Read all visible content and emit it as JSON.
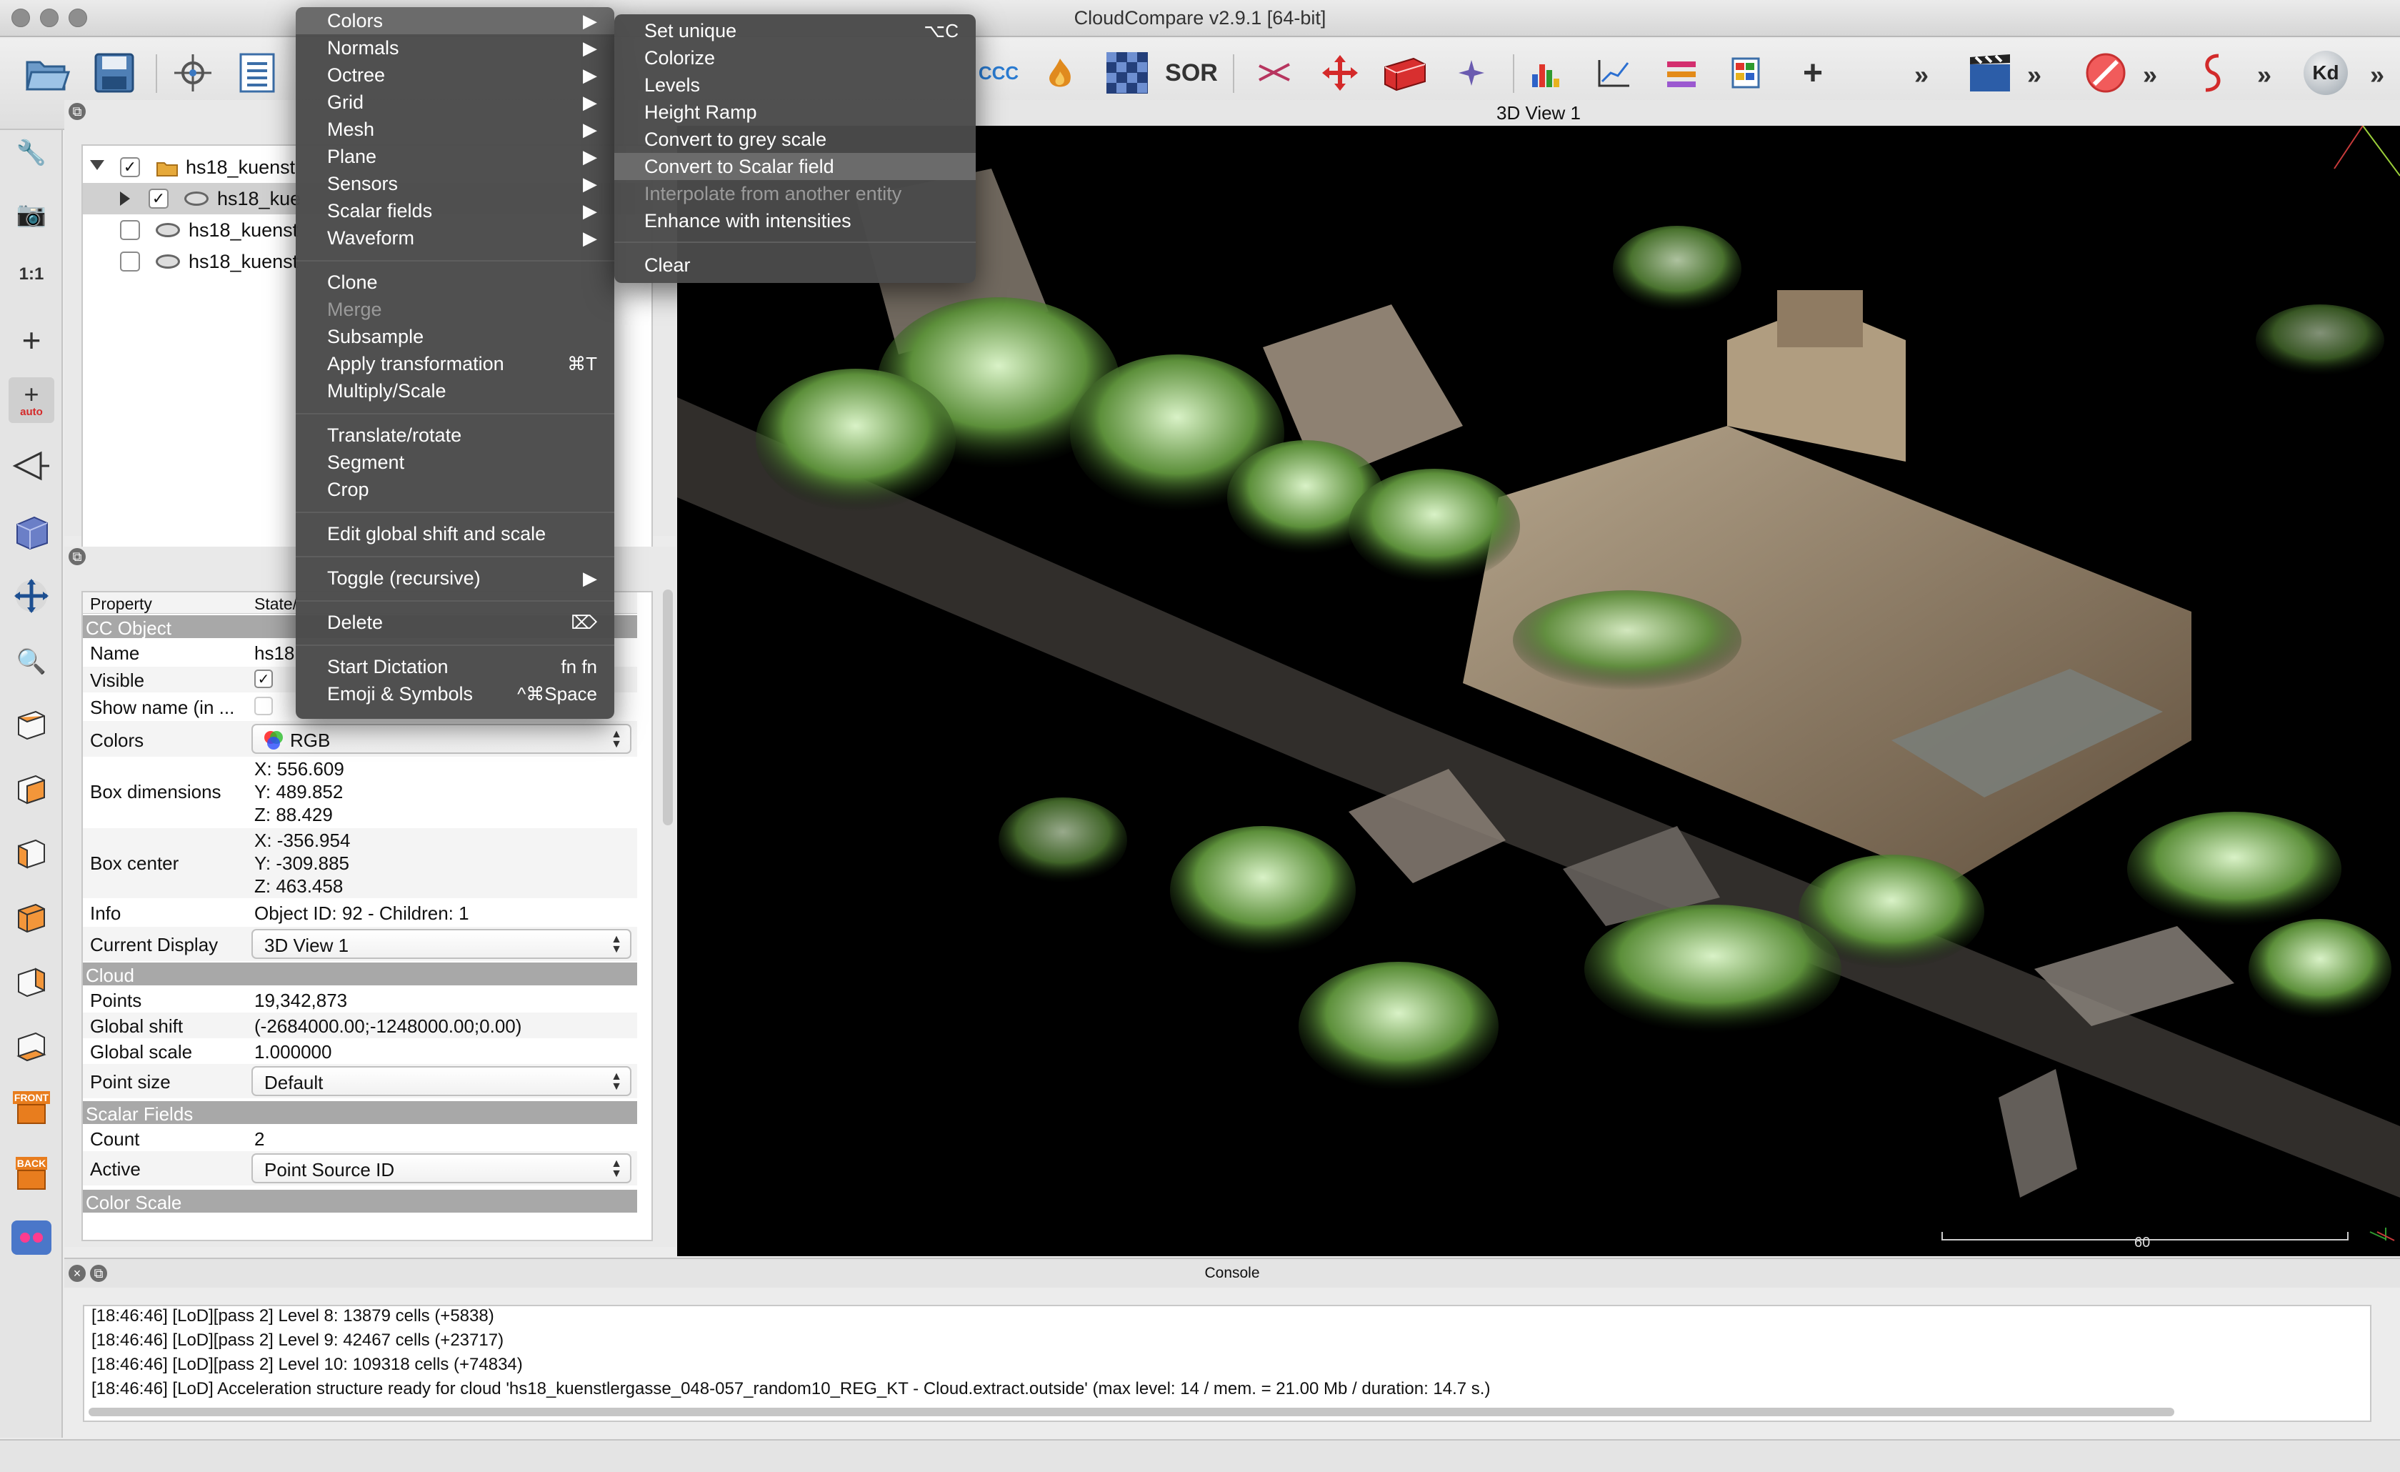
{
  "window": {
    "title": "CloudCompare v2.9.1 [64-bit]"
  },
  "toolbar": {
    "items": [
      "open-icon",
      "save-icon",
      "point-picking-icon",
      "properties-icon",
      "ccc-icon",
      "fire-icon",
      "checkerboard-icon",
      "sor-icon",
      "scissors-icon",
      "translate-icon",
      "red-box-icon",
      "fit-icon",
      "histogram-icon",
      "plot-icon",
      "minmax-icon",
      "table-icon",
      "plus-icon",
      "animation-icon",
      "stop-icon",
      "snake-icon",
      "kd-icon"
    ],
    "labels": {
      "ccc": "CCC",
      "sor": "SOR",
      "kd": "Kd"
    }
  },
  "left_toolbar": {
    "one_to_one": "1:1",
    "auto": "auto",
    "front": "FRONT",
    "back": "BACK"
  },
  "db_tree": {
    "rows": [
      {
        "label": "hs18_kuenst",
        "checked": true,
        "level": 0
      },
      {
        "label": "hs18_kue",
        "checked": true,
        "level": 1
      },
      {
        "label": "hs18_kuenst",
        "checked": false,
        "level": 1
      },
      {
        "label": "hs18_kuenst",
        "checked": false,
        "level": 1
      }
    ]
  },
  "properties": {
    "header": {
      "property": "Property",
      "state": "State/"
    },
    "sections": {
      "cc_object": "CC Object",
      "cloud": "Cloud",
      "scalar_fields": "Scalar Fields",
      "color_scale": "Color Scale"
    },
    "name": {
      "key": "Name",
      "value": "hs18"
    },
    "visible": {
      "key": "Visible",
      "checked": true
    },
    "show_name": {
      "key": "Show name (in ..."
    },
    "colors": {
      "key": "Colors",
      "value": "RGB"
    },
    "box_dimensions": {
      "key": "Box dimensions",
      "x": "X: 556.609",
      "y": "Y: 489.852",
      "z": "Z: 88.429"
    },
    "box_center": {
      "key": "Box center",
      "x": "X: -356.954",
      "y": "Y: -309.885",
      "z": "Z: 463.458"
    },
    "info": {
      "key": "Info",
      "value": "Object ID: 92 - Children: 1"
    },
    "current_display": {
      "key": "Current Display",
      "value": "3D View 1"
    },
    "points": {
      "key": "Points",
      "value": "19,342,873"
    },
    "global_shift": {
      "key": "Global shift",
      "value": "(-2684000.00;-1248000.00;0.00)"
    },
    "global_scale": {
      "key": "Global scale",
      "value": "1.000000"
    },
    "point_size": {
      "key": "Point size",
      "value": "Default"
    },
    "count": {
      "key": "Count",
      "value": "2"
    },
    "active": {
      "key": "Active",
      "value": "Point Source ID"
    }
  },
  "view3d": {
    "title": "3D View 1",
    "scale_label": "60"
  },
  "console": {
    "title": "Console",
    "lines": [
      "[18:46:46] [LoD][pass 2] Level 8: 13879 cells (+5838)",
      "[18:46:46] [LoD][pass 2] Level 9: 42467 cells (+23717)",
      "[18:46:46] [LoD][pass 2] Level 10: 109318 cells (+74834)",
      "[18:46:46] [LoD] Acceleration structure ready for cloud 'hs18_kuenstlergasse_048-057_random10_REG_KT - Cloud.extract.outside' (max level: 14 / mem. = 21.00 Mb / duration: 14.7 s.)"
    ]
  },
  "edit_menu": {
    "items": [
      {
        "label": "Colors",
        "submenu": true,
        "highlighted": true
      },
      {
        "label": "Normals",
        "submenu": true
      },
      {
        "label": "Octree",
        "submenu": true
      },
      {
        "label": "Grid",
        "submenu": true
      },
      {
        "label": "Mesh",
        "submenu": true
      },
      {
        "label": "Plane",
        "submenu": true
      },
      {
        "label": "Sensors",
        "submenu": true
      },
      {
        "label": "Scalar fields",
        "submenu": true
      },
      {
        "label": "Waveform",
        "submenu": true
      },
      {
        "label": "Clone"
      },
      {
        "label": "Merge",
        "disabled": true
      },
      {
        "label": "Subsample"
      },
      {
        "label": "Apply transformation",
        "shortcut": "⌘T"
      },
      {
        "label": "Multiply/Scale"
      },
      {
        "label": "Translate/rotate"
      },
      {
        "label": "Segment"
      },
      {
        "label": "Crop"
      },
      {
        "label": "Edit global shift and scale"
      },
      {
        "label": "Toggle (recursive)",
        "submenu": true
      },
      {
        "label": "Delete",
        "shortcut": "⌦"
      },
      {
        "label": "Start Dictation",
        "shortcut": "fn fn"
      },
      {
        "label": "Emoji & Symbols",
        "shortcut": "^⌘Space"
      }
    ]
  },
  "colors_submenu": {
    "items": [
      {
        "label": "Set unique",
        "shortcut": "⌥C"
      },
      {
        "label": "Colorize"
      },
      {
        "label": "Levels"
      },
      {
        "label": "Height Ramp"
      },
      {
        "label": "Convert to grey scale"
      },
      {
        "label": "Convert to Scalar field",
        "highlighted": true
      },
      {
        "label": "Interpolate from another entity",
        "disabled": true
      },
      {
        "label": "Enhance with intensities"
      },
      {
        "label": "Clear"
      }
    ]
  },
  "colors": {
    "menu_bg": "#4a4a4a",
    "menu_highlight": "#6b6b6b",
    "section_header": "#a8a8a8",
    "view_bg": "#000000"
  }
}
